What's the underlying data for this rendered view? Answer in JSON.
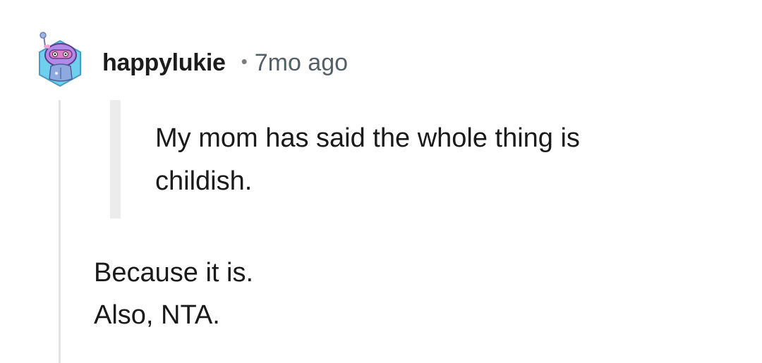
{
  "comment": {
    "username": "happylukie",
    "separator": "•",
    "timestamp": "7mo ago",
    "avatar_icon": "snoo-avatar-icon",
    "quote": "My mom has said the whole thing is childish.",
    "body_lines": [
      "Because it is.",
      "Also, NTA."
    ]
  },
  "colors": {
    "text": "#1a1a1a",
    "muted": "#555f66",
    "thread_line": "#e3e3e3",
    "quote_bar": "#ececec"
  }
}
